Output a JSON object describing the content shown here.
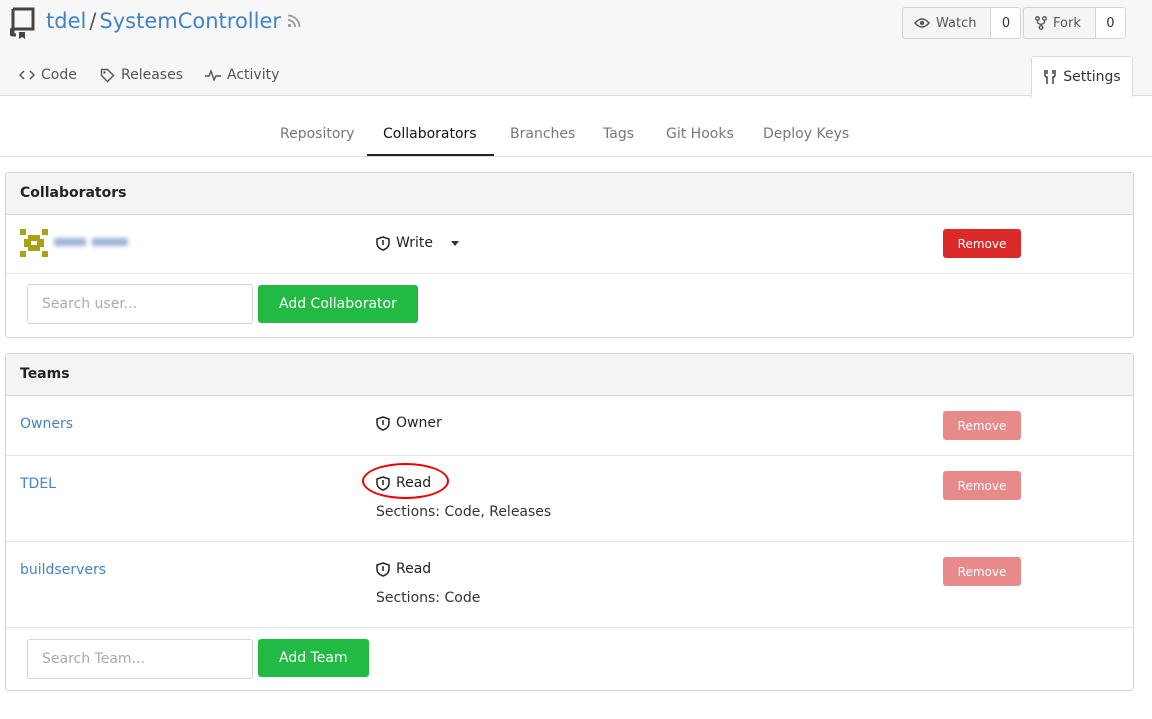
{
  "repo": {
    "owner": "tdel",
    "separator": "/",
    "name": "SystemController"
  },
  "header_buttons": {
    "watch": {
      "label": "Watch",
      "count": "0"
    },
    "fork": {
      "label": "Fork",
      "count": "0"
    }
  },
  "repo_tabs": [
    {
      "label": "Code",
      "icon": "code-icon"
    },
    {
      "label": "Releases",
      "icon": "tag-icon"
    },
    {
      "label": "Activity",
      "icon": "pulse-icon"
    }
  ],
  "settings_tab": {
    "label": "Settings",
    "icon": "tools-icon"
  },
  "settings_nav": [
    {
      "label": "Repository"
    },
    {
      "label": "Collaborators",
      "active": true
    },
    {
      "label": "Branches"
    },
    {
      "label": "Tags"
    },
    {
      "label": "Git Hooks"
    },
    {
      "label": "Deploy Keys"
    }
  ],
  "collaborators": {
    "title": "Collaborators",
    "rows": [
      {
        "permission": "Write",
        "remove_label": "Remove"
      }
    ],
    "search_placeholder": "Search user...",
    "add_label": "Add Collaborator"
  },
  "teams": {
    "title": "Teams",
    "rows": [
      {
        "name": "Owners",
        "permission": "Owner",
        "sections": "",
        "remove_label": "Remove"
      },
      {
        "name": "TDEL",
        "permission": "Read",
        "sections": "Sections: Code, Releases",
        "remove_label": "Remove"
      },
      {
        "name": "buildservers",
        "permission": "Read",
        "sections": "Sections: Code",
        "remove_label": "Remove"
      }
    ],
    "search_placeholder": "Search Team...",
    "add_label": "Add Team"
  },
  "colors": {
    "link": "#4183c4",
    "danger": "#db2828",
    "danger_disabled": "#e8898a",
    "success": "#21ba45",
    "annotation": "#e00000"
  }
}
